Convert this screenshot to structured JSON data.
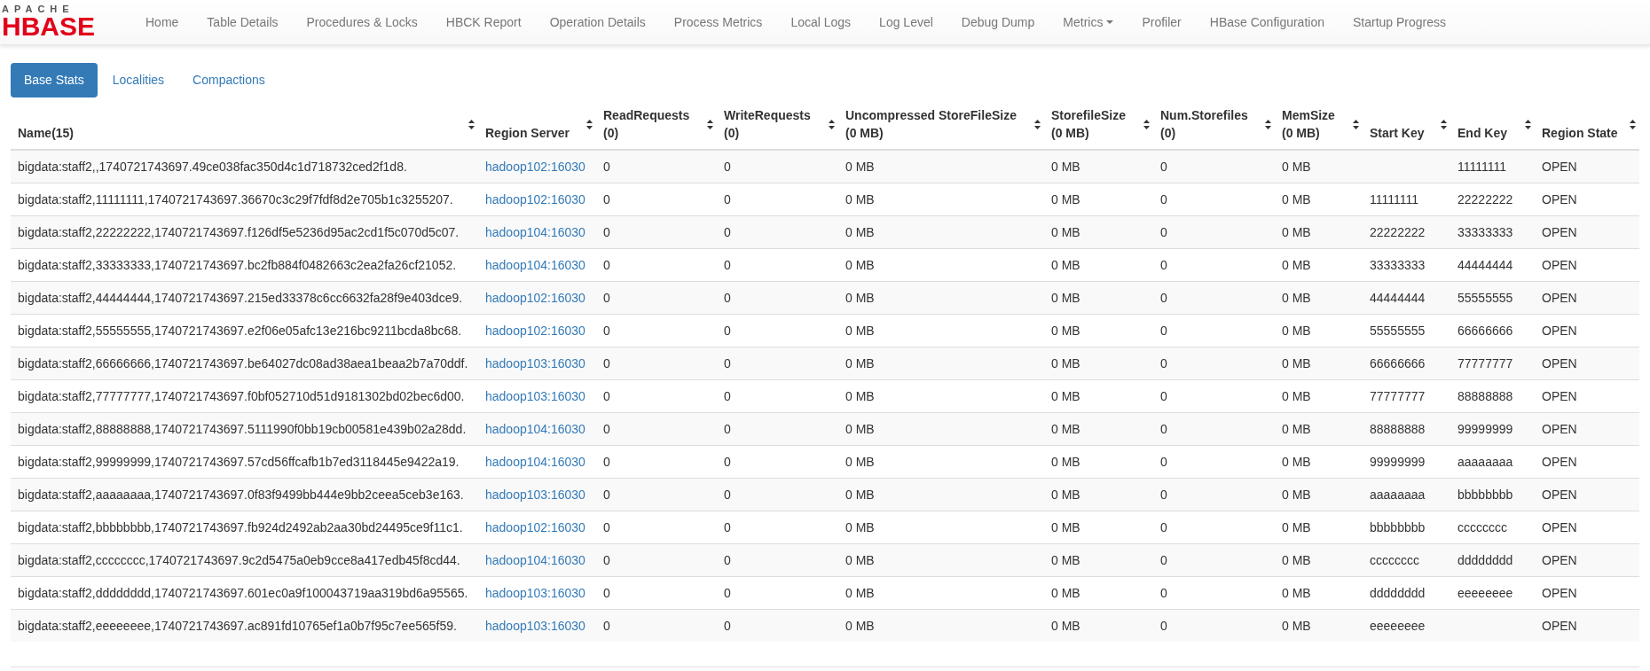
{
  "navbar": {
    "logo": {
      "top": "APACHE",
      "bottom": "HBASE"
    },
    "items": [
      {
        "label": "Home",
        "dropdown": false
      },
      {
        "label": "Table Details",
        "dropdown": false
      },
      {
        "label": "Procedures & Locks",
        "dropdown": false
      },
      {
        "label": "HBCK Report",
        "dropdown": false
      },
      {
        "label": "Operation Details",
        "dropdown": false
      },
      {
        "label": "Process Metrics",
        "dropdown": false
      },
      {
        "label": "Local Logs",
        "dropdown": false
      },
      {
        "label": "Log Level",
        "dropdown": false
      },
      {
        "label": "Debug Dump",
        "dropdown": false
      },
      {
        "label": "Metrics",
        "dropdown": true
      },
      {
        "label": "Profiler",
        "dropdown": false
      },
      {
        "label": "HBase Configuration",
        "dropdown": false
      },
      {
        "label": "Startup Progress",
        "dropdown": false
      }
    ]
  },
  "tabs": [
    {
      "label": "Base Stats",
      "selected": true
    },
    {
      "label": "Localities",
      "selected": false
    },
    {
      "label": "Compactions",
      "selected": false
    }
  ],
  "table": {
    "columns": [
      {
        "label": "Name(15)",
        "kind": "text"
      },
      {
        "label": "Region Server",
        "kind": "link"
      },
      {
        "label": "ReadRequests",
        "total": "(0)",
        "kind": "text"
      },
      {
        "label": "WriteRequests",
        "total": "(0)",
        "kind": "text"
      },
      {
        "label": "Uncompressed StoreFileSize",
        "total": "(0 MB)",
        "kind": "text"
      },
      {
        "label": "StorefileSize",
        "total": "(0 MB)",
        "kind": "text"
      },
      {
        "label": "Num.Storefiles",
        "total": "(0)",
        "kind": "text"
      },
      {
        "label": "MemSize",
        "total": "(0 MB)",
        "kind": "text"
      },
      {
        "label": "Start Key",
        "kind": "text"
      },
      {
        "label": "End Key",
        "kind": "text"
      },
      {
        "label": "Region State",
        "kind": "text"
      }
    ],
    "rows": [
      [
        "bigdata:staff2,,1740721743697.49ce038fac350d4c1d718732ced2f1d8.",
        "hadoop102:16030",
        "0",
        "0",
        "0 MB",
        "0 MB",
        "0",
        "0 MB",
        "",
        "11111111",
        "OPEN"
      ],
      [
        "bigdata:staff2,11111111,1740721743697.36670c3c29f7fdf8d2e705b1c3255207.",
        "hadoop102:16030",
        "0",
        "0",
        "0 MB",
        "0 MB",
        "0",
        "0 MB",
        "11111111",
        "22222222",
        "OPEN"
      ],
      [
        "bigdata:staff2,22222222,1740721743697.f126df5e5236d95ac2cd1f5c070d5c07.",
        "hadoop104:16030",
        "0",
        "0",
        "0 MB",
        "0 MB",
        "0",
        "0 MB",
        "22222222",
        "33333333",
        "OPEN"
      ],
      [
        "bigdata:staff2,33333333,1740721743697.bc2fb884f0482663c2ea2fa26cf21052.",
        "hadoop104:16030",
        "0",
        "0",
        "0 MB",
        "0 MB",
        "0",
        "0 MB",
        "33333333",
        "44444444",
        "OPEN"
      ],
      [
        "bigdata:staff2,44444444,1740721743697.215ed33378c6cc6632fa28f9e403dce9.",
        "hadoop102:16030",
        "0",
        "0",
        "0 MB",
        "0 MB",
        "0",
        "0 MB",
        "44444444",
        "55555555",
        "OPEN"
      ],
      [
        "bigdata:staff2,55555555,1740721743697.e2f06e05afc13e216bc9211bcda8bc68.",
        "hadoop102:16030",
        "0",
        "0",
        "0 MB",
        "0 MB",
        "0",
        "0 MB",
        "55555555",
        "66666666",
        "OPEN"
      ],
      [
        "bigdata:staff2,66666666,1740721743697.be64027dc08ad38aea1beaa2b7a70ddf.",
        "hadoop103:16030",
        "0",
        "0",
        "0 MB",
        "0 MB",
        "0",
        "0 MB",
        "66666666",
        "77777777",
        "OPEN"
      ],
      [
        "bigdata:staff2,77777777,1740721743697.f0bf052710d51d9181302bd02bec6d00.",
        "hadoop103:16030",
        "0",
        "0",
        "0 MB",
        "0 MB",
        "0",
        "0 MB",
        "77777777",
        "88888888",
        "OPEN"
      ],
      [
        "bigdata:staff2,88888888,1740721743697.5111990f0bb19cb00581e439b02a28dd.",
        "hadoop104:16030",
        "0",
        "0",
        "0 MB",
        "0 MB",
        "0",
        "0 MB",
        "88888888",
        "99999999",
        "OPEN"
      ],
      [
        "bigdata:staff2,99999999,1740721743697.57cd56ffcafb1b7ed3118445e9422a19.",
        "hadoop104:16030",
        "0",
        "0",
        "0 MB",
        "0 MB",
        "0",
        "0 MB",
        "99999999",
        "aaaaaaaa",
        "OPEN"
      ],
      [
        "bigdata:staff2,aaaaaaaa,1740721743697.0f83f9499bb444e9bb2ceea5ceb3e163.",
        "hadoop103:16030",
        "0",
        "0",
        "0 MB",
        "0 MB",
        "0",
        "0 MB",
        "aaaaaaaa",
        "bbbbbbbb",
        "OPEN"
      ],
      [
        "bigdata:staff2,bbbbbbbb,1740721743697.fb924d2492ab2aa30bd24495ce9f11c1.",
        "hadoop102:16030",
        "0",
        "0",
        "0 MB",
        "0 MB",
        "0",
        "0 MB",
        "bbbbbbbb",
        "cccccccc",
        "OPEN"
      ],
      [
        "bigdata:staff2,cccccccc,1740721743697.9c2d5475a0eb9cce8a417edb45f8cd44.",
        "hadoop104:16030",
        "0",
        "0",
        "0 MB",
        "0 MB",
        "0",
        "0 MB",
        "cccccccc",
        "dddddddd",
        "OPEN"
      ],
      [
        "bigdata:staff2,dddddddd,1740721743697.601ec0a9f100043719aa319bd6a95565.",
        "hadoop103:16030",
        "0",
        "0",
        "0 MB",
        "0 MB",
        "0",
        "0 MB",
        "dddddddd",
        "eeeeeeee",
        "OPEN"
      ],
      [
        "bigdata:staff2,eeeeeeee,1740721743697.ac891fd10765ef1a0b7f95c7ee565f59.",
        "hadoop103:16030",
        "0",
        "0",
        "0 MB",
        "0 MB",
        "0",
        "0 MB",
        "eeeeeeee",
        "",
        "OPEN"
      ]
    ]
  }
}
